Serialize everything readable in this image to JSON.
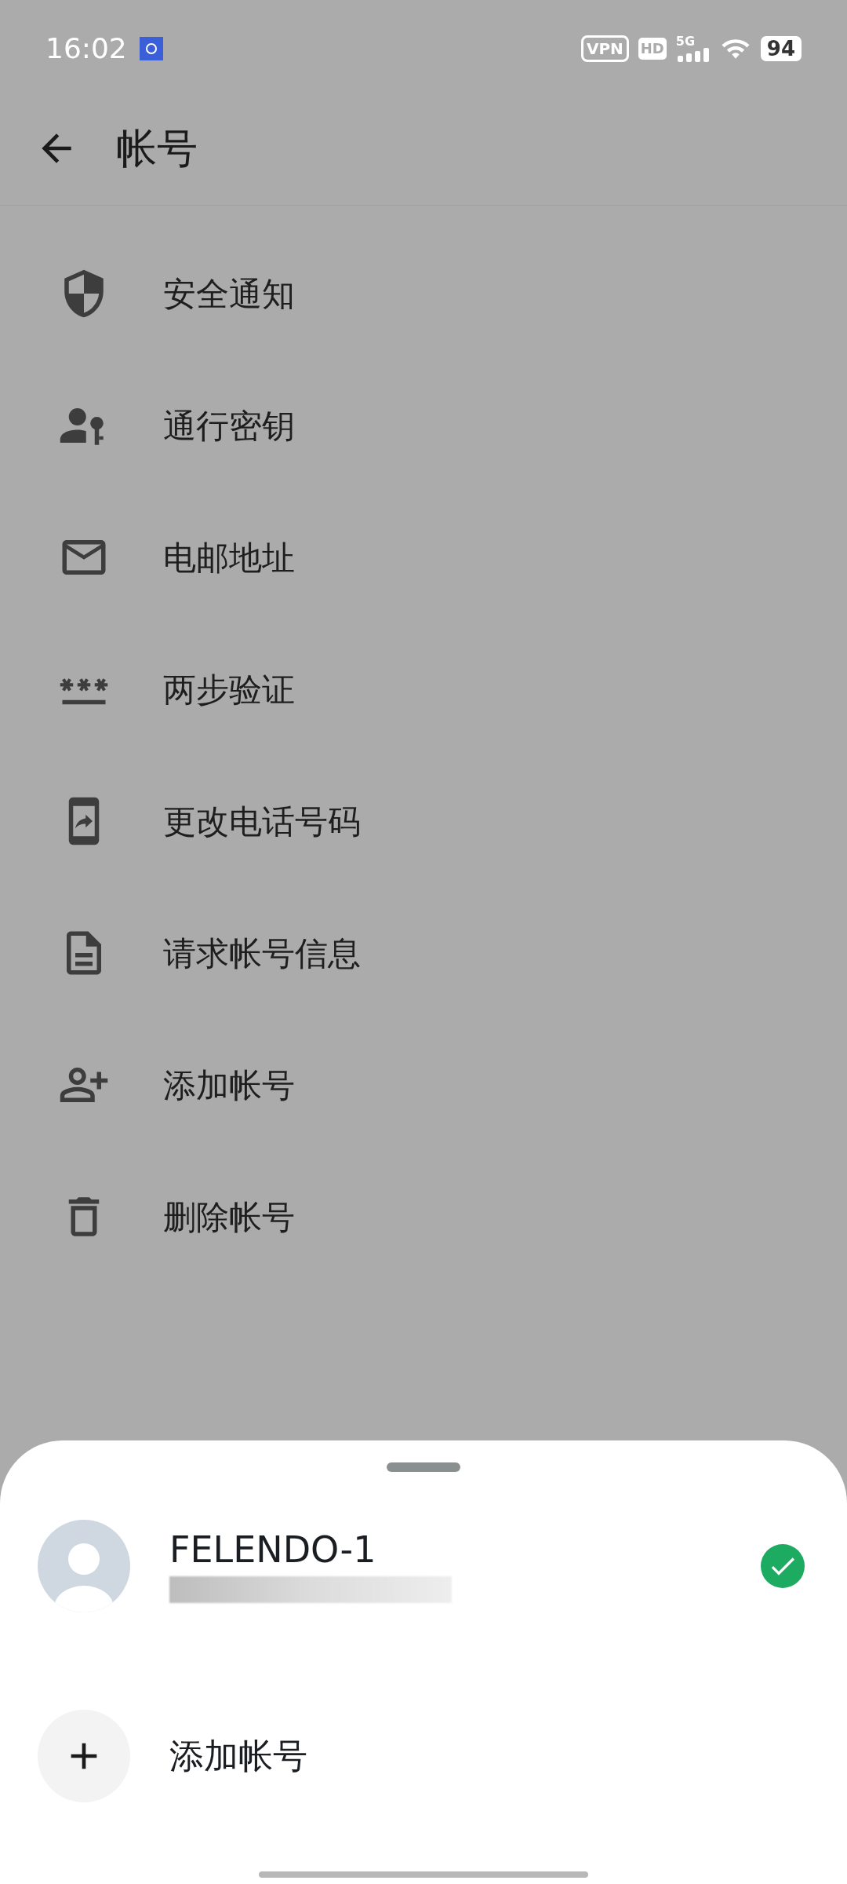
{
  "status_bar": {
    "time": "16:02",
    "vpn": "VPN",
    "hd": "HD",
    "network": "5G",
    "battery": "94"
  },
  "header": {
    "title": "帐号"
  },
  "menu": [
    {
      "kind": "shield",
      "label": "安全通知"
    },
    {
      "kind": "passkey",
      "label": "通行密钥"
    },
    {
      "kind": "email",
      "label": "电邮地址"
    },
    {
      "kind": "password",
      "label": "两步验证"
    },
    {
      "kind": "phone",
      "label": "更改电话号码"
    },
    {
      "kind": "document",
      "label": "请求帐号信息"
    },
    {
      "kind": "add_user",
      "label": "添加帐号"
    },
    {
      "kind": "delete",
      "label": "删除帐号"
    }
  ],
  "sheet": {
    "accounts": [
      {
        "name": "FELENDO-1",
        "selected": true
      }
    ],
    "add_account": "添加帐号"
  }
}
